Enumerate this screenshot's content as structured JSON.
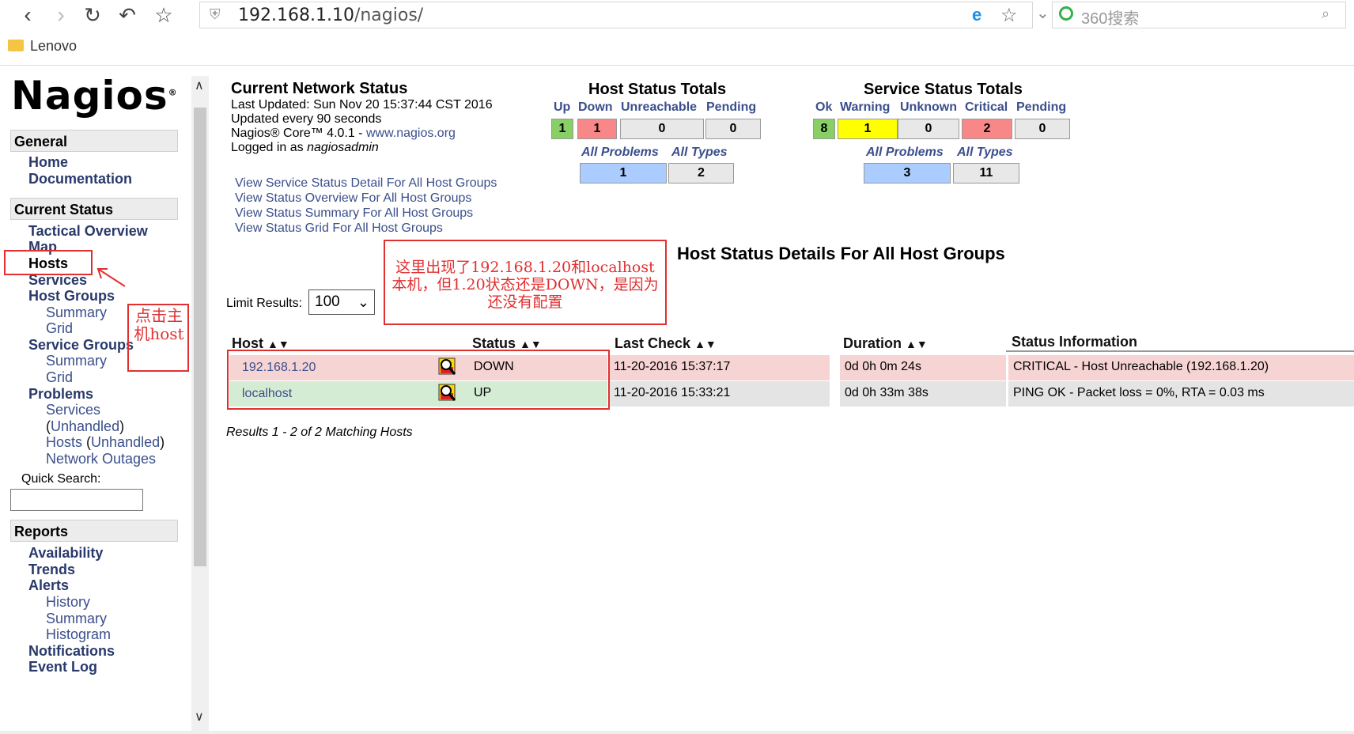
{
  "browser": {
    "url_host": "192.168.1.10",
    "url_path": "/nagios/",
    "search_placeholder": "360搜索",
    "bookmark_folder": "Lenovo"
  },
  "sidebar": {
    "logo": "Nagios",
    "general_heading": "General",
    "general_items": [
      "Home",
      "Documentation"
    ],
    "current_status_heading": "Current Status",
    "tactical": "Tactical Overview",
    "map": "Map",
    "hosts": "Hosts",
    "services": "Services",
    "host_groups": "Host Groups",
    "hg_summary": "Summary",
    "hg_grid": "Grid",
    "service_groups": "Service Groups",
    "sg_summary": "Summary",
    "sg_grid": "Grid",
    "problems": "Problems",
    "p_services": "Services",
    "p_unhandled_open": "(",
    "p_unhandled": "Unhandled",
    "p_unhandled_close": ")",
    "p_hosts": "Hosts",
    "p_network_outages": "Network Outages",
    "quick_search_label": "Quick Search:",
    "reports_heading": "Reports",
    "availability": "Availability",
    "trends": "Trends",
    "alerts": "Alerts",
    "a_history": "History",
    "a_summary": "Summary",
    "a_histogram": "Histogram",
    "notifications": "Notifications",
    "event_log": "Event Log"
  },
  "network_status": {
    "title": "Current Network Status",
    "last_updated": "Last Updated: Sun Nov 20 15:37:44 CST 2016",
    "updated_every": "Updated every 90 seconds",
    "core_prefix": "Nagios® Core™ 4.0.1 - ",
    "core_link": "www.nagios.org",
    "logged_in_prefix": "Logged in as ",
    "logged_in_user": "nagiosadmin",
    "links": [
      "View Service Status Detail For All Host Groups",
      "View Status Overview For All Host Groups",
      "View Status Summary For All Host Groups",
      "View Status Grid For All Host Groups"
    ]
  },
  "host_totals": {
    "title": "Host Status Totals",
    "labels": [
      "Up",
      "Down",
      "Unreachable",
      "Pending"
    ],
    "values": [
      "1",
      "1",
      "0",
      "0"
    ],
    "sub_labels": [
      "All Problems",
      "All Types"
    ],
    "sub_values": [
      "1",
      "2"
    ]
  },
  "service_totals": {
    "title": "Service Status Totals",
    "labels": [
      "Ok",
      "Warning",
      "Unknown",
      "Critical",
      "Pending"
    ],
    "values": [
      "8",
      "1",
      "0",
      "2",
      "0"
    ],
    "sub_labels": [
      "All Problems",
      "All Types"
    ],
    "sub_values": [
      "3",
      "11"
    ]
  },
  "details": {
    "title": "Host Status Details For All Host Groups",
    "limit_label": "Limit Results:",
    "limit_value": "100",
    "columns": [
      "Host",
      "Status",
      "Last Check",
      "Duration",
      "Status Information"
    ],
    "rows": [
      {
        "host": "192.168.1.20",
        "status": "DOWN",
        "last_check": "11-20-2016 15:37:17",
        "duration": "0d 0h 0m 24s",
        "info": "CRITICAL - Host Unreachable (192.168.1.20)"
      },
      {
        "host": "localhost",
        "status": "UP",
        "last_check": "11-20-2016 15:33:21",
        "duration": "0d 0h 33m 38s",
        "info": "PING OK - Packet loss = 0%, RTA = 0.03 ms"
      }
    ],
    "results_text": "Results 1 - 2 of 2 Matching Hosts"
  },
  "annotations": {
    "note": "这里出现了192.168.1.20和localhost本机，但1.20状态还是DOWN，是因为还没有配置",
    "click_hint": "点击主机host"
  },
  "colors": {
    "ok_green": "#88d066",
    "down_red": "#f88888",
    "warning_yellow": "#ffff00",
    "problem_blue": "#aaccff",
    "row_down_bg": "#f7d4d4",
    "row_up_bg": "#d4ecd4",
    "annotation_red": "#e03030"
  }
}
